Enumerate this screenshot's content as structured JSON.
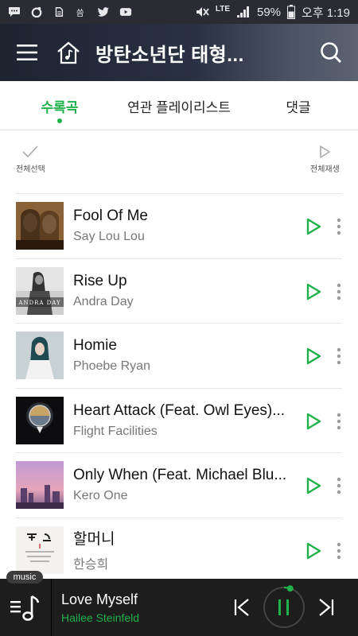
{
  "status_bar": {
    "signal_label": "LTE",
    "battery": "59%",
    "time": "오후 1:19",
    "left_icons": [
      "chat-icon",
      "record-icon",
      "file-icon",
      "sync-icon",
      "twitter-icon",
      "youtube-icon"
    ]
  },
  "header": {
    "title": "방탄소년단 태형..."
  },
  "tabs": [
    {
      "label": "수록곡",
      "active": true
    },
    {
      "label": "연관 플레이리스트",
      "active": false
    },
    {
      "label": "댓글",
      "active": false
    }
  ],
  "actions": {
    "select_all": "전체선택",
    "play_all": "전체재생"
  },
  "tracks": [
    {
      "title": "Fool Of Me",
      "artist": "Say Lou Lou"
    },
    {
      "title": "Rise Up",
      "artist": "Andra Day",
      "art_text": "ANDRA DAY"
    },
    {
      "title": "Homie",
      "artist": "Phoebe Ryan"
    },
    {
      "title": "Heart Attack (Feat. Owl Eyes)...",
      "artist": "Flight Facilities"
    },
    {
      "title": "Only When (Feat. Michael Blu...",
      "artist": "Kero One"
    },
    {
      "title": "할머니",
      "artist": "한승희"
    }
  ],
  "player": {
    "tag": "music",
    "title": "Love Myself",
    "artist": "Hailee Steinfeld",
    "progress": 0.05
  },
  "colors": {
    "accent": "#1fb24a",
    "player_bg": "#1d1d1d",
    "status_bar_bg": "#2a2b33"
  }
}
